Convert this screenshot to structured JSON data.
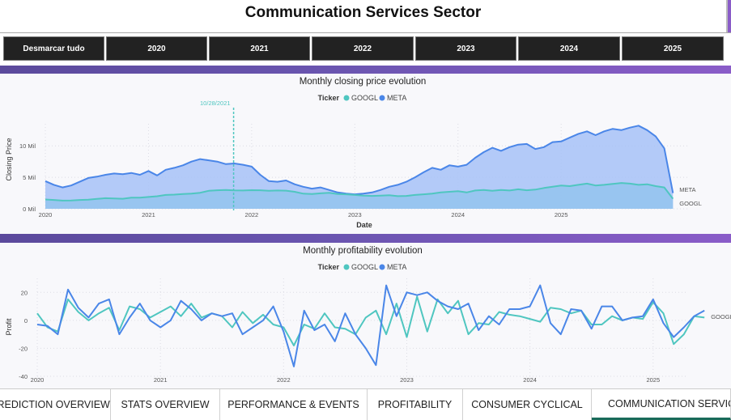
{
  "page": {
    "title": "Communication Services Sector"
  },
  "filters": [
    {
      "label": "Desmarcar tudo"
    },
    {
      "label": "2020"
    },
    {
      "label": "2021"
    },
    {
      "label": "2022"
    },
    {
      "label": "2023"
    },
    {
      "label": "2024"
    },
    {
      "label": "2025"
    }
  ],
  "tabs": [
    {
      "label": "PREDICTION OVERVIEW",
      "active": false
    },
    {
      "label": "STATS OVERVIEW",
      "active": false
    },
    {
      "label": "PERFORMANCE & EVENTS",
      "active": false
    },
    {
      "label": "PROFITABILITY",
      "active": false
    },
    {
      "label": "CONSUMER CYCLICAL",
      "active": false
    },
    {
      "label": "COMMUNICATION SERVICES",
      "active": true
    }
  ],
  "colors": {
    "googl": "#4fc6c0",
    "meta": "#4a86e8",
    "meta_fill": "#a7c2f7",
    "googl_fill": "#8fc3ee"
  },
  "chart_data": [
    {
      "type": "area",
      "title": "Monthly closing price evolution",
      "xlabel": "Date",
      "ylabel": "Closing Price",
      "legend_title": "Ticker",
      "legend": [
        "GOOGL",
        "META"
      ],
      "x_ticks": [
        "2020",
        "2021",
        "2022",
        "2023",
        "2024",
        "2025"
      ],
      "y_ticks": [
        "0 Mil",
        "5 Mil",
        "10 Mil"
      ],
      "ylim": [
        0,
        13500
      ],
      "x_start": "2020-01",
      "annotation": {
        "label": "10/28/2021",
        "month_index": 21.9
      },
      "series": [
        {
          "name": "GOOGL",
          "end_label": "GOOGL",
          "values": [
            1480,
            1400,
            1300,
            1330,
            1400,
            1450,
            1580,
            1680,
            1640,
            1600,
            1760,
            1780,
            1880,
            1990,
            2200,
            2250,
            2350,
            2400,
            2550,
            2850,
            2950,
            2980,
            2920,
            2900,
            2960,
            2950,
            2850,
            2900,
            2880,
            2700,
            2400,
            2350,
            2450,
            2550,
            2350,
            2300,
            2200,
            2100,
            2050,
            2100,
            2150,
            2000,
            2050,
            2200,
            2300,
            2400,
            2600,
            2700,
            2800,
            2600,
            2900,
            3000,
            2850,
            3000,
            2900,
            3100,
            2950,
            3050,
            3300,
            3500,
            3700,
            3600,
            3800,
            4000,
            3700,
            3800,
            3950,
            4100,
            4000,
            3800,
            3900,
            3600,
            3400,
            1600
          ]
        },
        {
          "name": "META",
          "end_label": "META",
          "values": [
            4400,
            3800,
            3400,
            3700,
            4300,
            4900,
            5100,
            5400,
            5600,
            5500,
            5700,
            5400,
            6000,
            5300,
            6200,
            6500,
            6900,
            7500,
            7900,
            7700,
            7500,
            7100,
            7200,
            7000,
            6700,
            5400,
            4400,
            4300,
            4500,
            3900,
            3500,
            3200,
            3400,
            3000,
            2600,
            2400,
            2300,
            2400,
            2600,
            3000,
            3500,
            3800,
            4300,
            5000,
            5800,
            6500,
            6200,
            6900,
            6700,
            7000,
            8100,
            9000,
            9700,
            9200,
            9800,
            10200,
            10300,
            9500,
            9800,
            10600,
            10700,
            11300,
            11900,
            12300,
            11700,
            12300,
            12700,
            12500,
            12900,
            13200,
            12500,
            11500,
            9600,
            2500
          ]
        }
      ]
    },
    {
      "type": "line",
      "title": "Monthly profitability evolution",
      "xlabel": "",
      "ylabel": "Profit",
      "legend_title": "Ticker",
      "legend": [
        "GOOGL",
        "META"
      ],
      "x_ticks": [
        "2020",
        "2021",
        "2022",
        "2023",
        "2024",
        "2025"
      ],
      "y_ticks": [
        "-40",
        "-20",
        "0",
        "20"
      ],
      "ylim": [
        -40,
        30
      ],
      "x_start": "2020-01",
      "series": [
        {
          "name": "GOOGL",
          "end_label": "GOOGL",
          "values": [
            5,
            -5,
            -8,
            15,
            6,
            0,
            5,
            9,
            -7,
            10,
            8,
            2,
            6,
            10,
            3,
            12,
            2,
            5,
            3,
            -5,
            6,
            -2,
            4,
            -3,
            -5,
            -18,
            -3,
            -6,
            5,
            -5,
            -6,
            -10,
            2,
            7,
            -10,
            12,
            -12,
            17,
            -8,
            15,
            5,
            14,
            -10,
            -2,
            -3,
            6,
            4,
            3,
            1,
            -1,
            9,
            8,
            5,
            7,
            -3,
            -3,
            3,
            0,
            2,
            1,
            13,
            5,
            -17,
            -10,
            3,
            2
          ]
        },
        {
          "name": "META",
          "end_label": "META",
          "values": [
            -3,
            -4,
            -10,
            22,
            9,
            2,
            12,
            15,
            -10,
            2,
            12,
            0,
            -5,
            0,
            14,
            8,
            0,
            5,
            3,
            5,
            -10,
            -5,
            0,
            10,
            -8,
            -33,
            7,
            -7,
            -3,
            -15,
            5,
            -10,
            -20,
            -32,
            25,
            3,
            20,
            18,
            20,
            14,
            10,
            8,
            12,
            -7,
            3,
            -3,
            8,
            8,
            10,
            25,
            -2,
            -10,
            8,
            7,
            -6,
            10,
            10,
            0,
            2,
            3,
            15,
            -2,
            -12,
            -5,
            3,
            7
          ]
        }
      ]
    }
  ]
}
